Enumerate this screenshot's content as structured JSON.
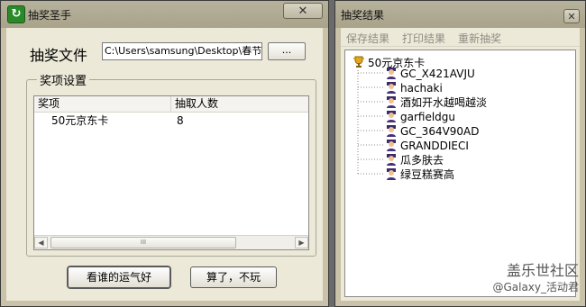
{
  "window1": {
    "title": "抽奖圣手",
    "close": "✕",
    "file_label": "抽奖文件",
    "file_path": "C:\\Users\\samsung\\Desktop\\春节活",
    "browse_label": "...",
    "group_title": "奖项设置",
    "columns": [
      "奖项",
      "抽取人数"
    ],
    "rows": [
      {
        "prize": "50元京东卡",
        "count": "8"
      }
    ],
    "scroll_thumb": "III",
    "lucky_button": "看谁的运气好",
    "quit_button": "算了，不玩"
  },
  "window2": {
    "title": "抽奖结果",
    "close": "✕",
    "menu": [
      "保存结果",
      "打印结果",
      "重新抽奖"
    ],
    "tree": {
      "root": "50元京东卡",
      "winners": [
        "GC_X421AVJU",
        "hachaki",
        "酒如开水越喝越淡",
        "garfieldgu",
        "GC_364V90AD",
        "GRANDDIECI",
        "瓜多肤去",
        "绿豆糕赛高"
      ]
    }
  },
  "watermark": {
    "line1": "盖乐世社区",
    "line2": "@Galaxy_活动君"
  },
  "colors": {
    "frame": "#c9c2a8",
    "client": "#ece9d8",
    "app_icon": "#2a8a2a"
  }
}
